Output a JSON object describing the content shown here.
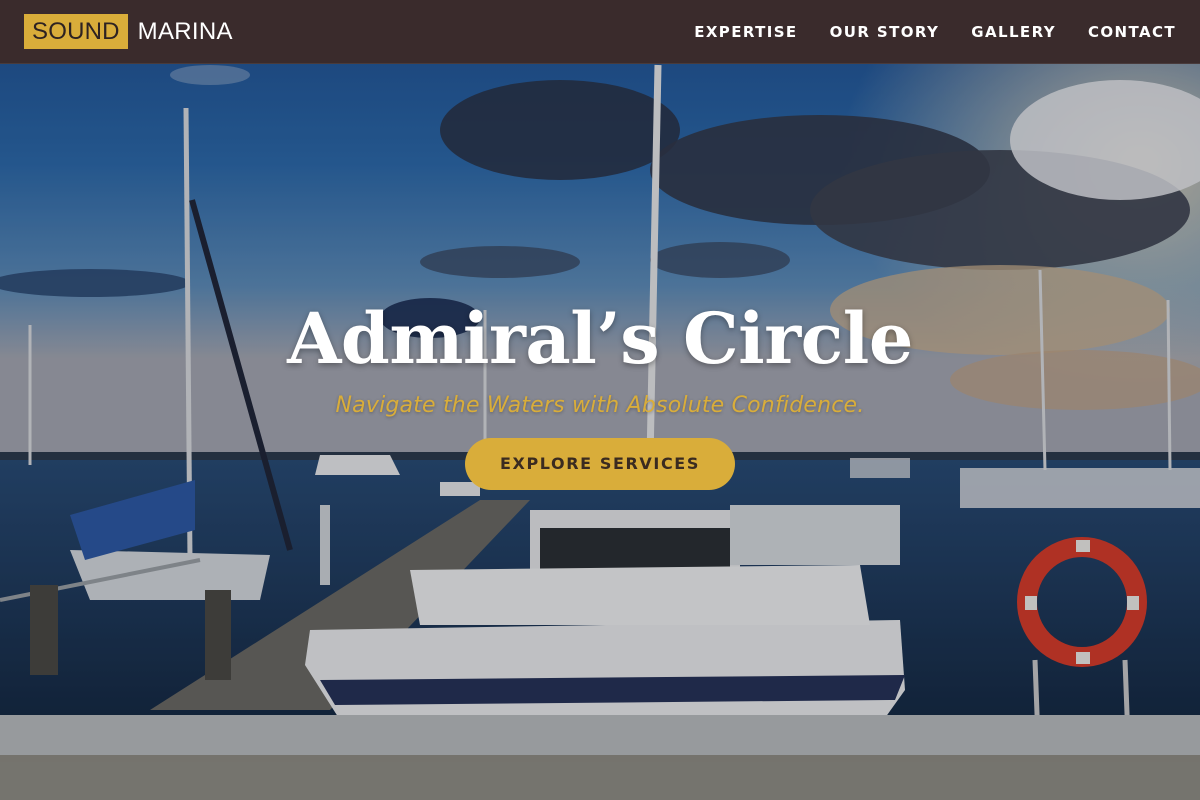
{
  "brand": {
    "logo_box_text": "SOUND",
    "logo_text": "MARINA"
  },
  "nav": {
    "items": [
      {
        "label": "EXPERTISE"
      },
      {
        "label": "OUR STORY"
      },
      {
        "label": "GALLERY"
      },
      {
        "label": "CONTACT"
      }
    ]
  },
  "hero": {
    "title": "Admiral’s Circle",
    "subtitle": "Navigate the Waters with Absolute Confidence.",
    "cta_label": "EXPLORE SERVICES",
    "background_scene": "marina-sunset-photo"
  },
  "colors": {
    "accent": "#d9ad3a",
    "navbar": "#3a2b2c",
    "text_light": "#ffffff"
  }
}
